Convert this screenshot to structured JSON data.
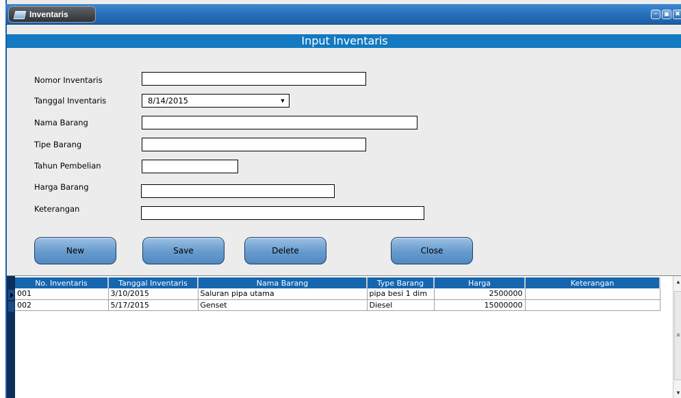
{
  "window": {
    "title": "Inventaris",
    "controls": [
      "minimize",
      "maximize",
      "close"
    ]
  },
  "form": {
    "header": "Input Inventaris",
    "fields": {
      "nomor_inventaris": {
        "label": "Nomor Inventaris",
        "value": ""
      },
      "tanggal_inventaris": {
        "label": "Tanggal Inventaris",
        "value": "8/14/2015"
      },
      "nama_barang": {
        "label": "Nama Barang",
        "value": ""
      },
      "tipe_barang": {
        "label": "Tipe Barang",
        "value": ""
      },
      "tahun_pembelian": {
        "label": "Tahun Pembelian",
        "value": ""
      },
      "harga_barang": {
        "label": "Harga Barang",
        "value": ""
      },
      "keterangan": {
        "label": "Keterangan",
        "value": ""
      }
    },
    "buttons": {
      "new": "New",
      "save": "Save",
      "delete": "Delete",
      "close": "Close"
    }
  },
  "grid": {
    "columns": [
      "No. Inventaris",
      "Tanggal Inventaris",
      "Nama Barang",
      "Type Barang",
      "Harga",
      "Keterangan"
    ],
    "rows": [
      [
        "001",
        "3/10/2015",
        "Saluran pipa utama",
        "pipa besi 1 dim",
        "2500000",
        ""
      ],
      [
        "002",
        "5/17/2015",
        "Genset",
        "Diesel",
        "15000000",
        ""
      ]
    ]
  },
  "colors": {
    "titlebar": "#2a72bd",
    "header": "#1379c1",
    "button": "#6a9dce"
  }
}
